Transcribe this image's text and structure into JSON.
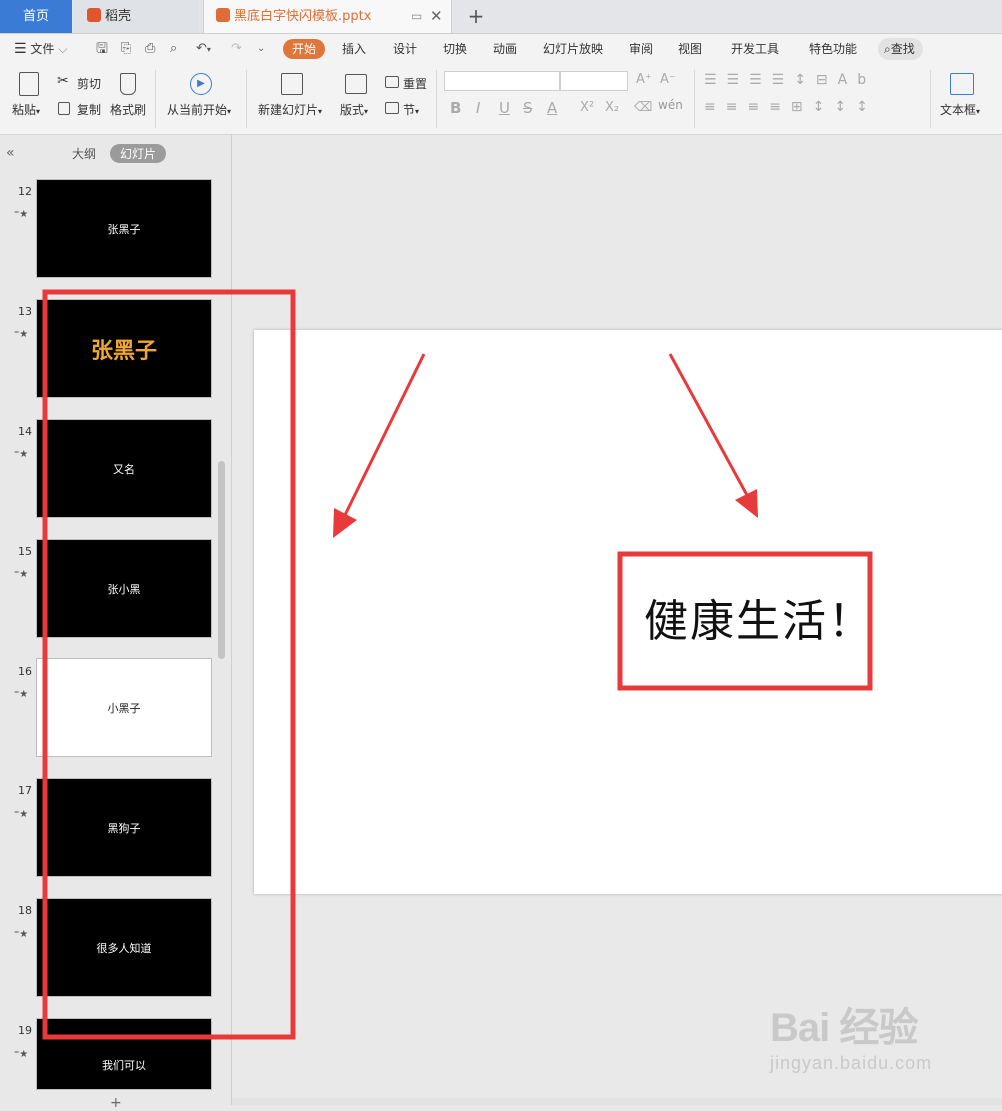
{
  "tabs": {
    "home": "首页",
    "daoke": "稻壳",
    "file": "黑底白字快闪模板.pptx"
  },
  "menu": {
    "file": "文件",
    "items": [
      "开始",
      "插入",
      "设计",
      "切换",
      "动画",
      "幻灯片放映",
      "审阅",
      "视图",
      "开发工具",
      "特色功能"
    ],
    "search": "查找"
  },
  "ribbon": {
    "paste": "粘贴",
    "cut": "剪切",
    "copy": "复制",
    "format_painter": "格式刷",
    "play_from_current": "从当前开始",
    "new_slide": "新建幻灯片",
    "layout": "版式",
    "reset": "重置",
    "section": "节",
    "textbox": "文本框",
    "bold": "B",
    "italic": "I",
    "underline": "U",
    "strike": "S",
    "fontcolor": "A"
  },
  "panel": {
    "outline": "大纲",
    "slides": "幻灯片",
    "slide_list": [
      {
        "num": "12",
        "text": "张黑子"
      },
      {
        "num": "13",
        "text": "张黑子"
      },
      {
        "num": "14",
        "text": "又名"
      },
      {
        "num": "15",
        "text": "张小黑"
      },
      {
        "num": "16",
        "text": "小黑子"
      },
      {
        "num": "17",
        "text": "黑狗子"
      },
      {
        "num": "18",
        "text": "很多人知道"
      },
      {
        "num": "19",
        "text": "我们可以"
      }
    ]
  },
  "canvas": {
    "text": "健康生活！"
  },
  "watermark": {
    "logo": "Bai 经验",
    "url": "jingyan.baidu.com"
  },
  "colors": {
    "accent": "#e0763a",
    "annotation": "#e83a3a",
    "home_tab": "#3a7bd5"
  }
}
